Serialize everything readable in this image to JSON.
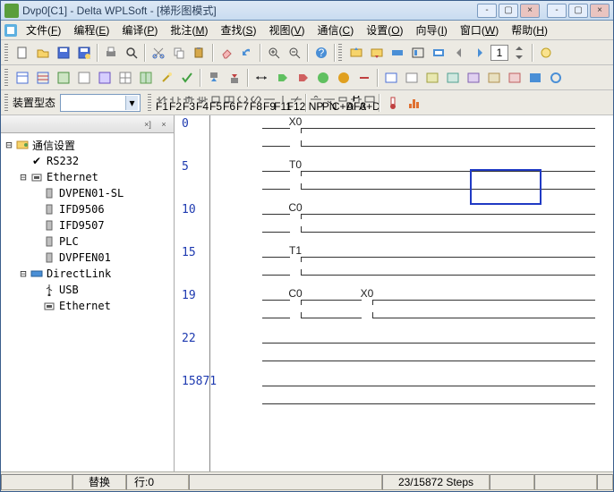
{
  "title": "Dvp0[C1] - Delta WPLSoft - [梯形图模式]",
  "winbtns": {
    "min": "-",
    "max": "▢",
    "close": "×",
    "min2": "-",
    "max2": "▢",
    "close2": "×"
  },
  "menu": {
    "file": {
      "label": "文件",
      "k": "F"
    },
    "edit": {
      "label": "编程",
      "k": "E"
    },
    "compile": {
      "label": "编译",
      "k": "P"
    },
    "batch": {
      "label": "批注",
      "k": "M"
    },
    "find": {
      "label": "查找",
      "k": "S"
    },
    "view": {
      "label": "视图",
      "k": "V"
    },
    "comm": {
      "label": "通信",
      "k": "C"
    },
    "option": {
      "label": "设置",
      "k": "O"
    },
    "wizard": {
      "label": "向导",
      "k": "I"
    },
    "window": {
      "label": "窗口",
      "k": "W"
    },
    "help": {
      "label": "帮助",
      "k": "H"
    }
  },
  "toolbar_num": "1",
  "type_label": "装置型态",
  "fkeys": [
    "F1",
    "F2",
    "F3",
    "F4",
    "F5",
    "F6",
    "F7",
    "F8",
    "F9",
    "F11",
    "F12",
    "NP",
    "PN",
    "C+D",
    "AF3",
    "A+D"
  ],
  "tree": {
    "root": "通信设置",
    "rs232": "RS232",
    "ethernet": "Ethernet",
    "dvpen01": "DVPEN01-SL",
    "ifd9506": "IFD9506",
    "ifd9507": "IFD9507",
    "plc": "PLC",
    "dvpfen01": "DVPFEN01",
    "directlink": "DirectLink",
    "usb": "USB",
    "ethernet2": "Ethernet"
  },
  "ladder": {
    "steps": [
      "0",
      "5",
      "10",
      "15",
      "19",
      "22",
      "15871"
    ],
    "rungs": [
      {
        "contacts": [
          "X0"
        ]
      },
      {
        "contacts": [
          "T0"
        ]
      },
      {
        "contacts": [
          "C0"
        ]
      },
      {
        "contacts": [
          "T1"
        ]
      },
      {
        "contacts": [
          "C0",
          "X0"
        ]
      },
      {
        "contacts": []
      },
      {
        "contacts": []
      }
    ]
  },
  "status": {
    "replace": "替换",
    "row_lbl": "行:",
    "row_val": "0",
    "steps": "23/15872 Steps"
  }
}
